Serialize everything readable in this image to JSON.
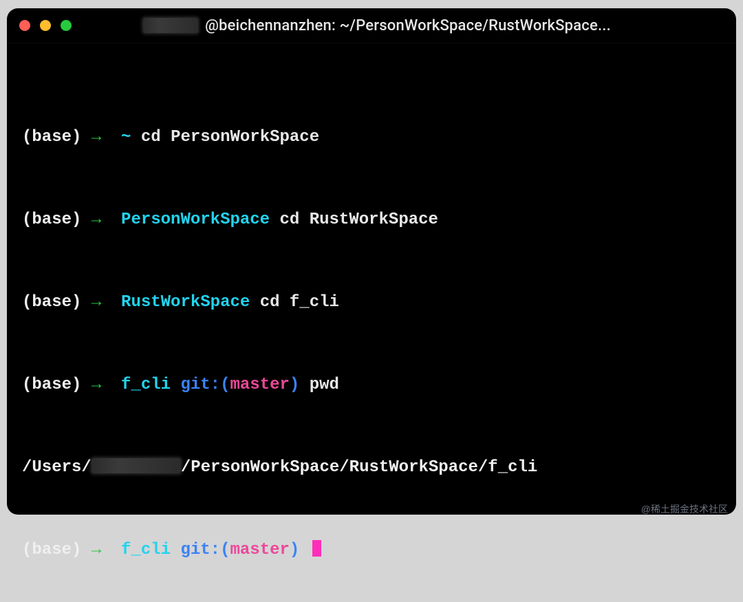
{
  "window": {
    "title": "@beichennanzhen: ~/PersonWorkSpace/RustWorkSpace..."
  },
  "prompt": {
    "env": "(base)",
    "arrow": "→",
    "git_label": "git:(",
    "git_close": ")",
    "branch": "master",
    "tilde": "~"
  },
  "lines": {
    "l1_cmd": "cd PersonWorkSpace",
    "l2_dir": "PersonWorkSpace",
    "l2_cmd": "cd RustWorkSpace",
    "l3_dir": "RustWorkSpace",
    "l3_cmd": "cd f_cli",
    "l4_dir": "f_cli",
    "l4_cmd": "pwd",
    "l5_out_pre": "/Users/",
    "l5_out_post": "/PersonWorkSpace/RustWorkSpace/f_cli",
    "l6_dir": "f_cli"
  },
  "watermark": "@稀土掘金技术社区"
}
